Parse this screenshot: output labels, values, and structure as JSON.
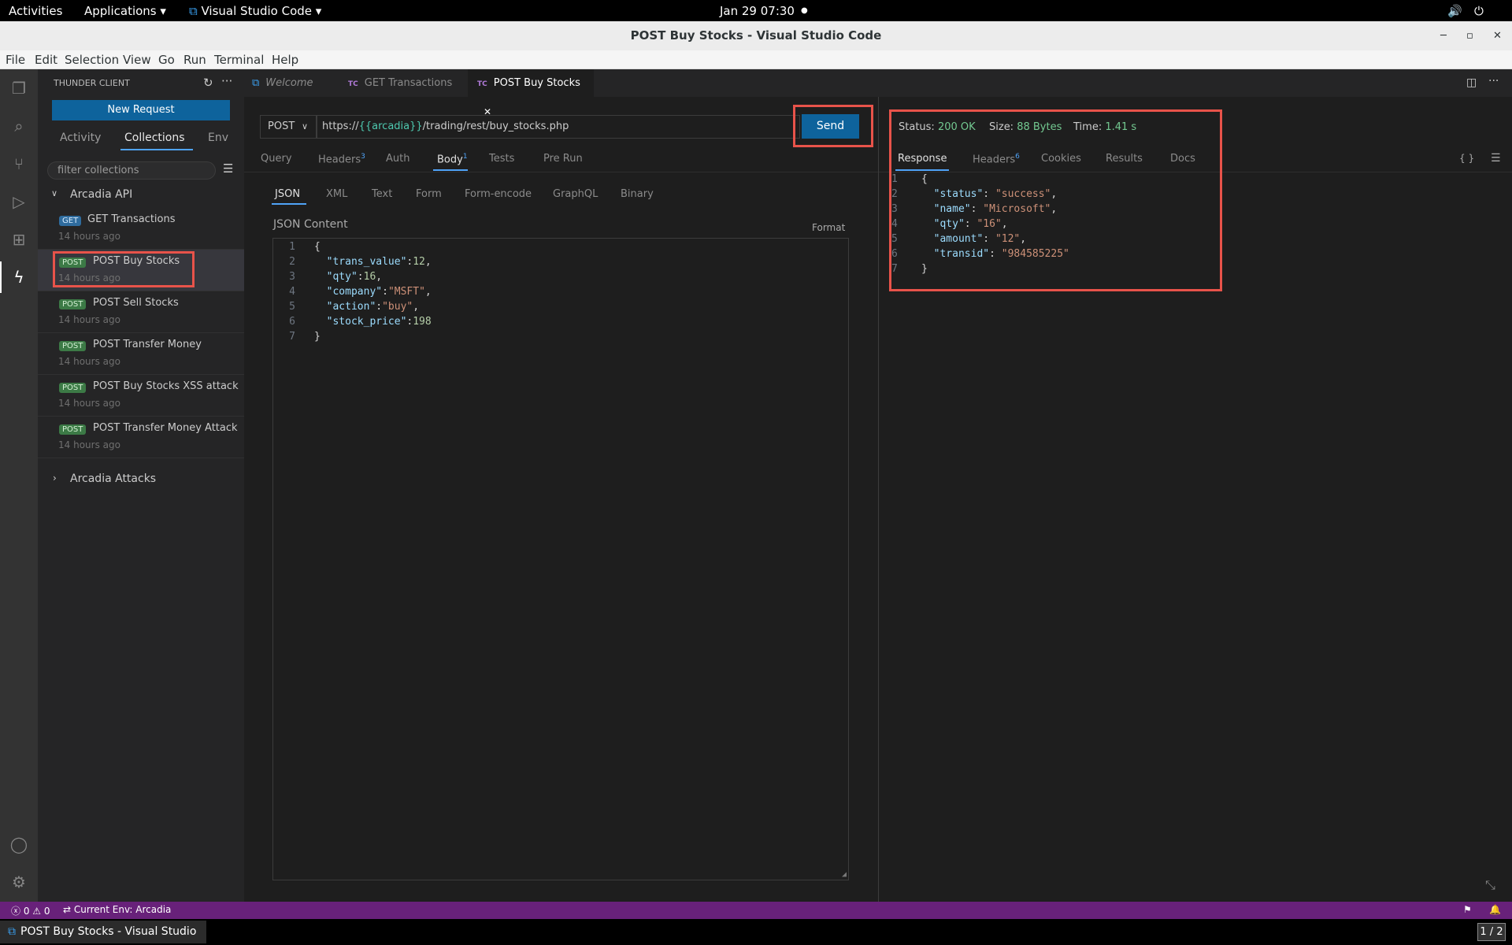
{
  "system": {
    "activities": "Activities",
    "applications": "Applications",
    "app": "Visual Studio Code",
    "clock": "Jan 29  07:30"
  },
  "window": {
    "title": "POST Buy Stocks - Visual Studio Code"
  },
  "menu": [
    "File",
    "Edit",
    "Selection",
    "View",
    "Go",
    "Run",
    "Terminal",
    "Help"
  ],
  "sidebar": {
    "title": "THUNDER CLIENT",
    "new_request": "New Request",
    "tabs": [
      "Activity",
      "Collections",
      "Env"
    ],
    "filter_placeholder": "filter collections",
    "collection_name": "Arcadia API",
    "items": [
      {
        "method": "GET",
        "name": "GET Transactions",
        "time": "14 hours ago"
      },
      {
        "method": "POST",
        "name": "POST Buy Stocks",
        "time": "14 hours ago"
      },
      {
        "method": "POST",
        "name": "POST Sell Stocks",
        "time": "14 hours ago"
      },
      {
        "method": "POST",
        "name": "POST Transfer Money",
        "time": "14 hours ago"
      },
      {
        "method": "POST",
        "name": "POST Buy Stocks XSS attack",
        "time": "14 hours ago"
      },
      {
        "method": "POST",
        "name": "POST Transfer Money Attack",
        "time": "14 hours ago"
      }
    ],
    "collection2_name": "Arcadia Attacks"
  },
  "tabs": {
    "welcome": "Welcome",
    "get_transactions": "GET Transactions",
    "post_buy_stocks": "POST Buy Stocks",
    "tc": "TC"
  },
  "request": {
    "method": "POST",
    "url_prefix": "https://",
    "url_var": "{{arcadia}}",
    "url_path": "/trading/rest/buy_stocks.php",
    "send": "Send",
    "tabs": {
      "query": "Query",
      "headers": "Headers",
      "headers_count": "3",
      "auth": "Auth",
      "body": "Body",
      "body_count": "1",
      "tests": "Tests",
      "prerun": "Pre Run"
    },
    "body_types": [
      "JSON",
      "XML",
      "Text",
      "Form",
      "Form-encode",
      "GraphQL",
      "Binary"
    ],
    "json_content_label": "JSON Content",
    "format": "Format"
  },
  "response": {
    "status_label": "Status:",
    "status_value": "200 OK",
    "size_label": "Size:",
    "size_value": "88 Bytes",
    "time_label": "Time:",
    "time_value": "1.41 s",
    "tabs": {
      "response": "Response",
      "headers": "Headers",
      "headers_count": "6",
      "cookies": "Cookies",
      "results": "Results",
      "docs": "Docs"
    },
    "braces": "{ }"
  },
  "statusbar": {
    "errors": "0",
    "warnings": "0",
    "env": "Current Env: Arcadia"
  },
  "taskbar": {
    "window": "POST Buy Stocks - Visual Studio C...",
    "workspace": "1 / 2"
  },
  "colors": {
    "statusbar": "#68217a",
    "send": "#0e639c",
    "highlight": "#e8534a",
    "ok": "#73c991"
  }
}
